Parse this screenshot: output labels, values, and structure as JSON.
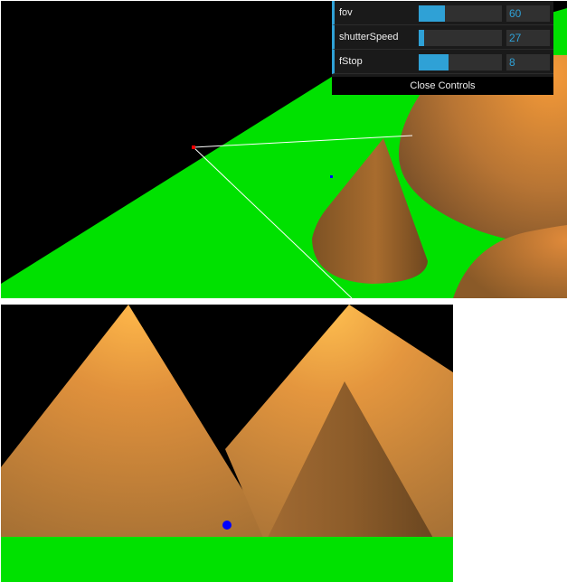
{
  "controls": [
    {
      "label": "fov",
      "value": "60",
      "level": 0.32
    },
    {
      "label": "shutterSpeed",
      "value": "27",
      "level": 0.06
    },
    {
      "label": "fStop",
      "value": "8",
      "level": 0.36
    }
  ],
  "close_label": "Close Controls",
  "colors": {
    "ground": "#00e100",
    "background": "#000000",
    "cone_light": "#f29a3a",
    "cone_dark": "#7a5020",
    "accent": "#2fa1d6",
    "marker": "#0000ff"
  }
}
